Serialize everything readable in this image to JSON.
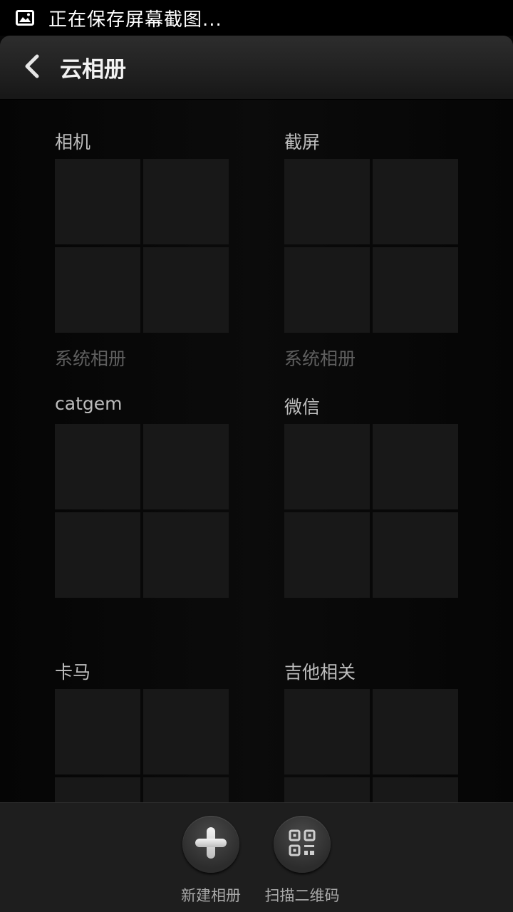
{
  "status_bar": {
    "text": "正在保存屏幕截图...",
    "icon": "image-icon"
  },
  "action_bar": {
    "title": "云相册",
    "back_icon": "chevron-left-icon"
  },
  "albums": [
    {
      "title": "相机",
      "subtitle": "系统相册"
    },
    {
      "title": "截屏",
      "subtitle": "系统相册"
    },
    {
      "title": "catgem",
      "subtitle": ""
    },
    {
      "title": "微信",
      "subtitle": ""
    },
    {
      "title": "卡马",
      "subtitle": ""
    },
    {
      "title": "吉他相关",
      "subtitle": ""
    }
  ],
  "bottom_bar": {
    "new_album_label": "新建相册",
    "new_album_icon": "plus-icon",
    "scan_qr_label": "扫描二维码",
    "scan_qr_icon": "qr-code-icon"
  },
  "colors": {
    "background": "#070707",
    "thumbnail": "#181818",
    "bottom_bar": "#1e1e1e"
  }
}
